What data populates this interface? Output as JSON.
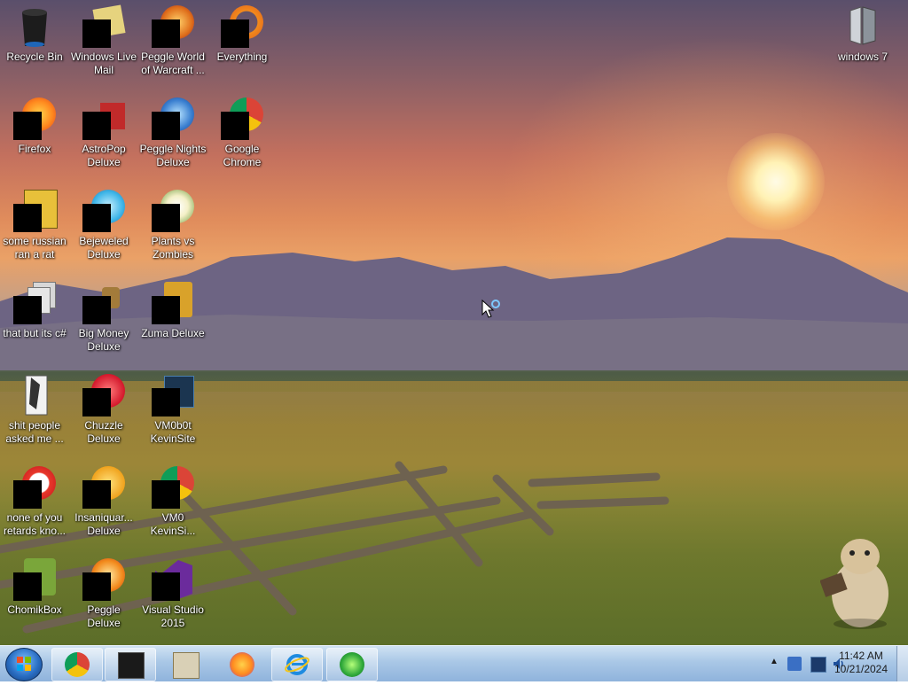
{
  "desktop": {
    "icons": [
      {
        "label": "Recycle Bin"
      },
      {
        "label": "Windows Live Mail"
      },
      {
        "label": "Peggle World of Warcraft ..."
      },
      {
        "label": "Everything"
      },
      {
        "label": "windows 7"
      },
      {
        "label": "Firefox"
      },
      {
        "label": "AstroPop Deluxe"
      },
      {
        "label": "Peggle Nights Deluxe"
      },
      {
        "label": "Google Chrome"
      },
      {
        "label": "some russian ran a rat"
      },
      {
        "label": "Bejeweled Deluxe"
      },
      {
        "label": "Plants vs Zombies"
      },
      {
        "label": "that but its c#"
      },
      {
        "label": "Big Money Deluxe"
      },
      {
        "label": "Zuma Deluxe"
      },
      {
        "label": "shit people asked me ..."
      },
      {
        "label": "Chuzzle Deluxe"
      },
      {
        "label": "VM0b0t KevinSite"
      },
      {
        "label": "none of you retards kno..."
      },
      {
        "label": "Insaniquar... Deluxe"
      },
      {
        "label": "VM0 KevinSi..."
      },
      {
        "label": "ChomikBox"
      },
      {
        "label": "Peggle Deluxe"
      },
      {
        "label": "Visual Studio 2015"
      }
    ]
  },
  "taskbar": {
    "pinned": [
      {
        "icon": "chrome-icon"
      },
      {
        "icon": "terminal-icon"
      },
      {
        "icon": "media-player-icon"
      },
      {
        "icon": "firefox-icon"
      },
      {
        "icon": "internet-explorer-icon"
      },
      {
        "icon": "network-globe-icon"
      }
    ],
    "clock": {
      "time": "11:42 AM",
      "date": "10/21/2024"
    }
  },
  "colors": {
    "taskbar": "#a9c7e6",
    "sun": "#fff2b5"
  }
}
